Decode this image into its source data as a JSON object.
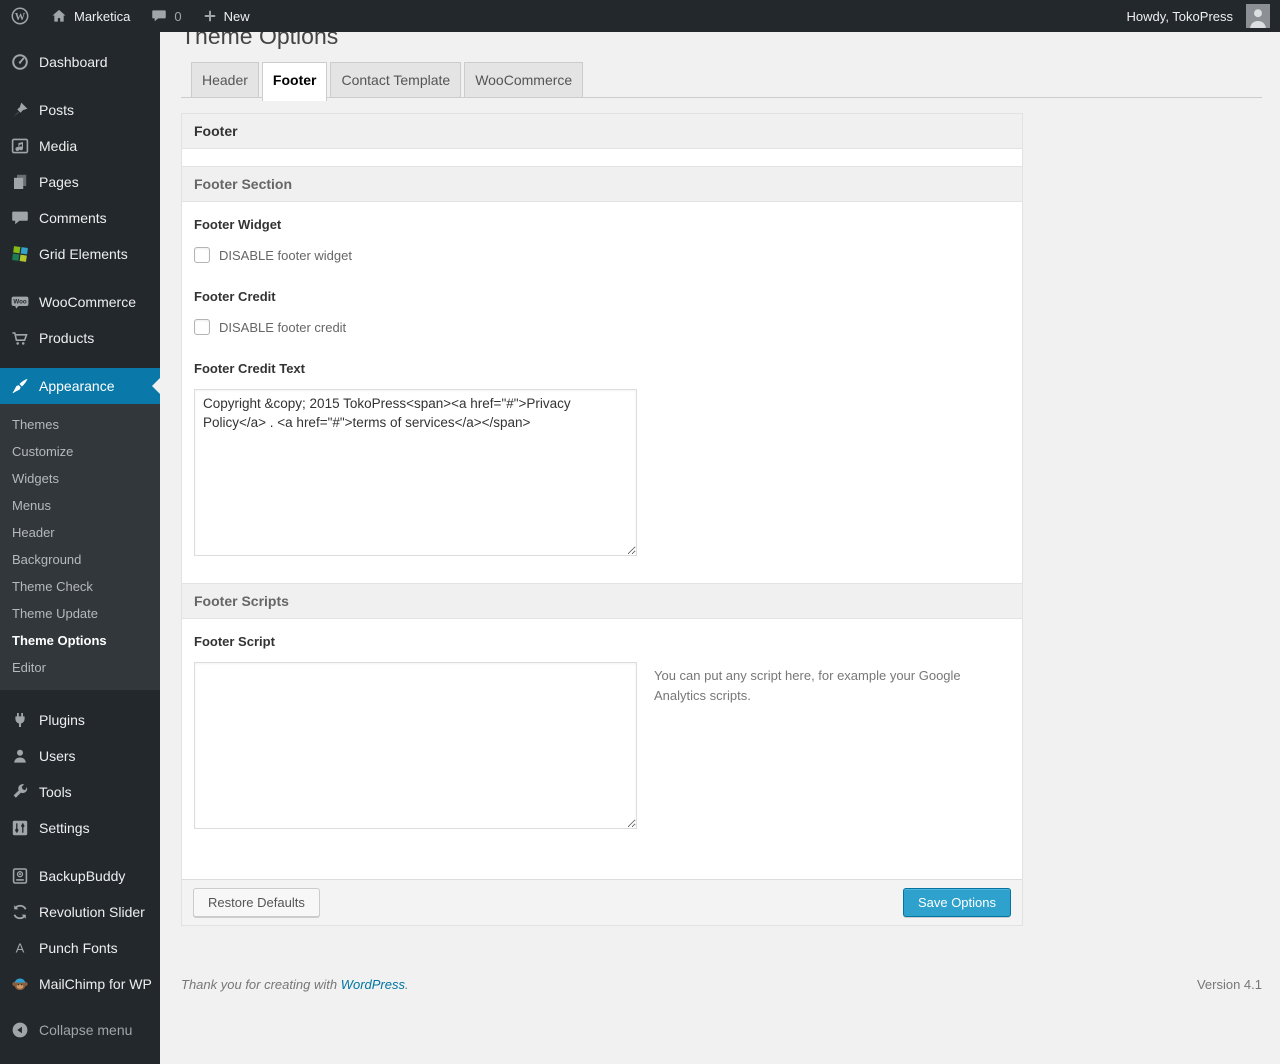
{
  "admin_bar": {
    "site_name": "Marketica",
    "comment_count": "0",
    "new_label": "New",
    "howdy": "Howdy, TokoPress"
  },
  "sidebar": {
    "dashboard": "Dashboard",
    "posts": "Posts",
    "media": "Media",
    "pages": "Pages",
    "comments": "Comments",
    "grid_elements": "Grid Elements",
    "woocommerce": "WooCommerce",
    "products": "Products",
    "appearance": "Appearance",
    "submenu": {
      "themes": "Themes",
      "customize": "Customize",
      "widgets": "Widgets",
      "menus": "Menus",
      "header": "Header",
      "background": "Background",
      "theme_check": "Theme Check",
      "theme_update": "Theme Update",
      "theme_options": "Theme Options",
      "editor": "Editor"
    },
    "plugins": "Plugins",
    "users": "Users",
    "tools": "Tools",
    "settings": "Settings",
    "backupbuddy": "BackupBuddy",
    "revolution_slider": "Revolution Slider",
    "punch_fonts": "Punch Fonts",
    "mailchimp": "MailChimp for WP",
    "collapse": "Collapse menu"
  },
  "page": {
    "title": "Theme Options",
    "tabs": {
      "header": "Header",
      "footer": "Footer",
      "contact": "Contact Template",
      "woocommerce": "WooCommerce"
    }
  },
  "panel": {
    "section_title": "Footer",
    "subsection_footer": "Footer Section",
    "subsection_scripts": "Footer Scripts",
    "footer_widget_label": "Footer Widget",
    "footer_widget_checkbox": "DISABLE footer widget",
    "footer_credit_label": "Footer Credit",
    "footer_credit_checkbox": "DISABLE footer credit",
    "footer_credit_text_label": "Footer Credit Text",
    "footer_credit_text_value": "Copyright &copy; 2015 TokoPress<span><a href=\"#\">Privacy Policy</a> . <a href=\"#\">terms of services</a></span>",
    "footer_script_label": "Footer Script",
    "footer_script_value": "",
    "footer_script_description": "You can put any script here, for example your Google Analytics scripts.",
    "restore_button": "Restore Defaults",
    "save_button": "Save Options"
  },
  "footer": {
    "thanks": "Thank you for creating with",
    "wordpress_link": "WordPress",
    "period": ".",
    "version": "Version 4.1"
  },
  "colors": {
    "accent_blue": "#0a78a8",
    "button_blue": "#2ea2cc",
    "admin_dark": "#23282d",
    "submenu_dark": "#32373c",
    "page_background": "#f1f1f1"
  }
}
